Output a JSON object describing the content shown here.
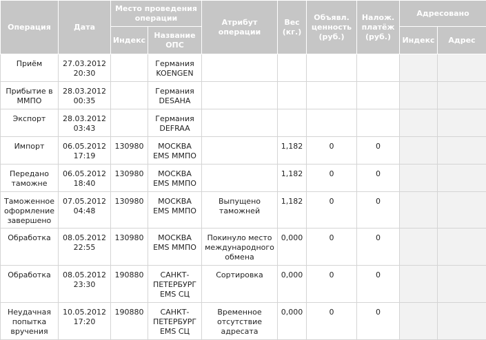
{
  "headers": {
    "operation": "Операция",
    "date": "Дата",
    "place": "Место проведения операции",
    "index": "Индекс",
    "office_name": "Название ОПС",
    "attribute": "Атрибут операции",
    "weight": "Вес (кг.)",
    "declared_value": "Объявл. ценность (руб.)",
    "cod": "Налож. платёж (руб.)",
    "addressed": "Адресовано",
    "addr_index": "Индекс",
    "addr_address": "Адрес"
  },
  "rows": [
    {
      "operation": "Приём",
      "date": "27.03.2012 20:30",
      "index": "",
      "office": "Германия KOENGEN",
      "attribute": "",
      "weight": "",
      "declared": "",
      "cod": "",
      "addr_index": "",
      "addr_address": ""
    },
    {
      "operation": "Прибытие в ММПО",
      "date": "28.03.2012 00:35",
      "index": "",
      "office": "Германия DESAHA",
      "attribute": "",
      "weight": "",
      "declared": "",
      "cod": "",
      "addr_index": "",
      "addr_address": ""
    },
    {
      "operation": "Экспорт",
      "date": "28.03.2012 03:43",
      "index": "",
      "office": "Германия DEFRAA",
      "attribute": "",
      "weight": "",
      "declared": "",
      "cod": "",
      "addr_index": "",
      "addr_address": ""
    },
    {
      "operation": "Импорт",
      "date": "06.05.2012 17:19",
      "index": "130980",
      "office": "МОСКВА EMS ММПО",
      "attribute": "",
      "weight": "1,182",
      "declared": "0",
      "cod": "0",
      "addr_index": "",
      "addr_address": ""
    },
    {
      "operation": "Передано таможне",
      "date": "06.05.2012 18:40",
      "index": "130980",
      "office": "МОСКВА EMS ММПО",
      "attribute": "",
      "weight": "1,182",
      "declared": "0",
      "cod": "0",
      "addr_index": "",
      "addr_address": ""
    },
    {
      "operation": "Таможенное оформление завершено",
      "date": "07.05.2012 04:48",
      "index": "130980",
      "office": "МОСКВА EMS ММПО",
      "attribute": "Выпущено таможней",
      "weight": "1,182",
      "declared": "0",
      "cod": "0",
      "addr_index": "",
      "addr_address": ""
    },
    {
      "operation": "Обработка",
      "date": "08.05.2012 22:55",
      "index": "130980",
      "office": "МОСКВА EMS ММПО",
      "attribute": "Покинуло место международного обмена",
      "weight": "0,000",
      "declared": "0",
      "cod": "0",
      "addr_index": "",
      "addr_address": ""
    },
    {
      "operation": "Обработка",
      "date": "08.05.2012 23:30",
      "index": "190880",
      "office": "САНКТ-ПЕТЕРБУРГ EMS СЦ",
      "attribute": "Сортировка",
      "weight": "0,000",
      "declared": "0",
      "cod": "0",
      "addr_index": "",
      "addr_address": ""
    },
    {
      "operation": "Неудачная попытка вручения",
      "date": "10.05.2012 17:20",
      "index": "190880",
      "office": "САНКТ-ПЕТЕРБУРГ EMS СЦ",
      "attribute": "Временное отсутствие адресата",
      "weight": "0,000",
      "declared": "0",
      "cod": "0",
      "addr_index": "",
      "addr_address": ""
    }
  ]
}
